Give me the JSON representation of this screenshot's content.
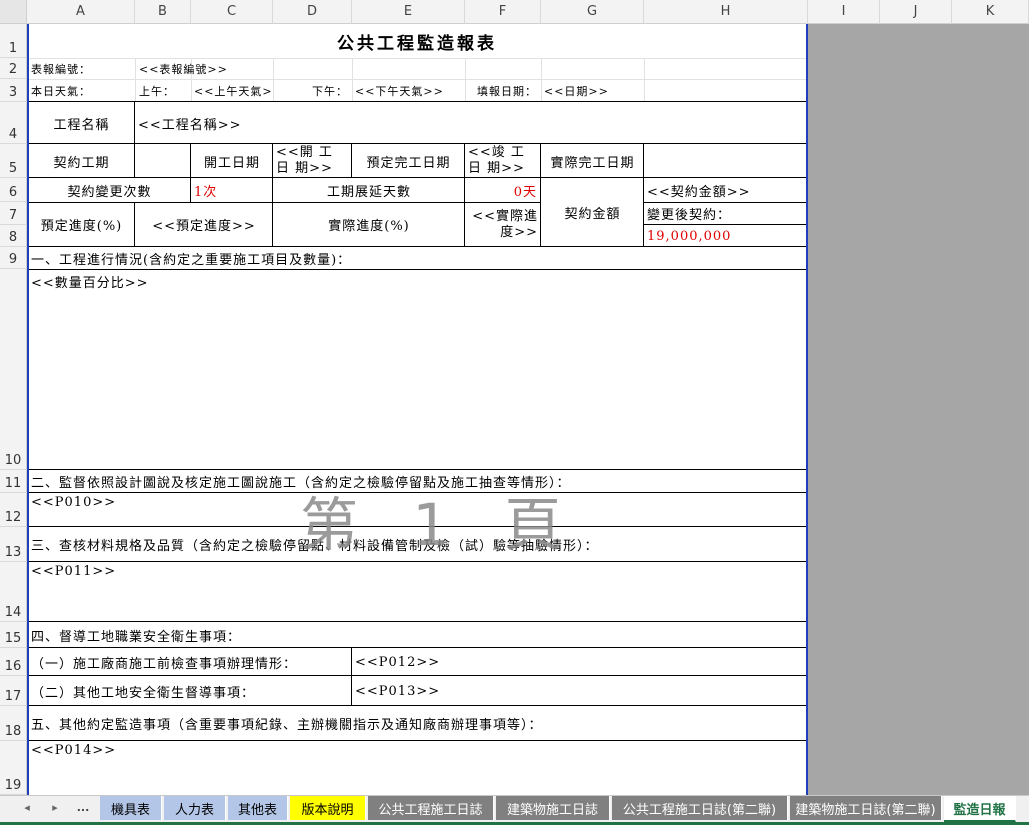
{
  "columns": [
    "A",
    "B",
    "C",
    "D",
    "E",
    "F",
    "G",
    "H",
    "I",
    "J",
    "K"
  ],
  "rows": [
    "1",
    "2",
    "3",
    "4",
    "5",
    "6",
    "7",
    "8",
    "9",
    "10",
    "11",
    "12",
    "13",
    "14",
    "15",
    "16",
    "17",
    "18",
    "19"
  ],
  "report": {
    "title": "公共工程監造報表",
    "report_no_label": "表報編號：",
    "report_no_value": "<<表報編號>>",
    "weather_label": "本日天氣：",
    "am_label": "上午：",
    "am_value": "<<上午天氣>>",
    "pm_label": "下午：",
    "pm_value": "<<下午天氣>>",
    "fill_date_label": "填報日期：",
    "fill_date_value": "<<日期>>",
    "project_name_label": "工程名稱",
    "project_name_value": "<<工程名稱>>",
    "contract_period_label": "契約工期",
    "start_date_label": "開工日期",
    "start_date_value": "<<開 工 日 期>>",
    "planned_finish_label": "預定完工日期",
    "completion_value": "<<竣 工 日 期>>",
    "actual_finish_label": "實際完工日期",
    "change_count_label": "契約變更次數",
    "change_count_value": "1次",
    "extension_label": "工期展延天數",
    "extension_value": "0天",
    "contract_amount_label": "契約金額",
    "contract_amount_value": "<<契約金額>>",
    "changed_contract_label": "變更後契約：",
    "changed_contract_value": "19,000,000",
    "planned_progress_label": "預定進度(%)",
    "planned_progress_value": "<<預定進度>>",
    "actual_progress_label": "實際進度(%)",
    "actual_progress_value": "<<實際進 度>>",
    "section1_label": "一、工程進行情況(含約定之重要施工項目及數量)：",
    "section1_value": "<<數量百分比>>",
    "section2_label": "二、監督依照設計圖說及核定施工圖說施工（含約定之檢驗停留點及施工抽查等情形）：",
    "section2_value": "<<P010>>",
    "section3_label": "三、查核材料規格及品質（含約定之檢驗停留點、材料設備管制及檢（試）驗等抽驗情形）：",
    "section3_value": "<<P011>>",
    "section4_label": "四、督導工地職業安全衛生事項：",
    "section4_1_label": "（一）施工廠商施工前檢查事項辦理情形：",
    "section4_1_value": "<<P012>>",
    "section4_2_label": "（二）其他工地安全衛生督導事項：",
    "section4_2_value": "<<P013>>",
    "section5_label": "五、其他約定監造事項（含重要事項紀錄、主辦機關指示及通知廠商辦理事項等）：",
    "section5_value": "<<P014>>",
    "watermark": "第 1 頁"
  },
  "tabs": {
    "more": "...",
    "items": [
      {
        "label": "機具表",
        "color": "#b4c6e7"
      },
      {
        "label": "人力表",
        "color": "#b4c6e7"
      },
      {
        "label": "其他表",
        "color": "#b4c6e7"
      },
      {
        "label": "版本說明",
        "color": "#ffff00"
      },
      {
        "label": "公共工程施工日誌",
        "color": "#808080"
      },
      {
        "label": "建築物施工日誌",
        "color": "#808080"
      },
      {
        "label": "公共工程施工日誌(第二聯)",
        "color": "#808080"
      },
      {
        "label": "建築物施工日誌(第二聯)",
        "color": "#808080"
      },
      {
        "label": "監造日報",
        "color": "#ffffff",
        "active": true
      }
    ]
  }
}
